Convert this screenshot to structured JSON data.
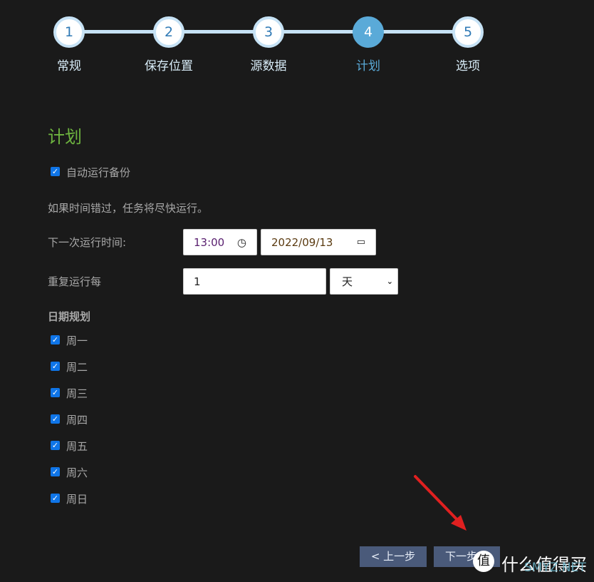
{
  "stepper": {
    "steps": [
      {
        "number": "1",
        "label": "常规"
      },
      {
        "number": "2",
        "label": "保存位置"
      },
      {
        "number": "3",
        "label": "源数据"
      },
      {
        "number": "4",
        "label": "计划"
      },
      {
        "number": "5",
        "label": "选项"
      }
    ],
    "active_step": 4,
    "accent": "#5aaad8"
  },
  "section": {
    "title": "计划",
    "title_color": "#6db33f"
  },
  "auto_run": {
    "label": "自动运行备份",
    "checked": true
  },
  "notice": "如果时间错过，任务将尽快运行。",
  "next_run": {
    "label": "下一次运行时间:",
    "time": "13:00",
    "date": "2022/09/13"
  },
  "repeat": {
    "label": "重复运行每",
    "value": "1",
    "unit": "天"
  },
  "schedule": {
    "heading": "日期规划",
    "days": [
      {
        "label": "周一",
        "checked": true
      },
      {
        "label": "周二",
        "checked": true
      },
      {
        "label": "周三",
        "checked": true
      },
      {
        "label": "周四",
        "checked": true
      },
      {
        "label": "周五",
        "checked": true
      },
      {
        "label": "周六",
        "checked": true
      },
      {
        "label": "周日",
        "checked": true
      }
    ]
  },
  "buttons": {
    "prev": "< 上一步",
    "next": "下一步"
  },
  "watermark": {
    "text": "什么值得买",
    "sub": "SMYZ.NET",
    "badge": "值"
  }
}
